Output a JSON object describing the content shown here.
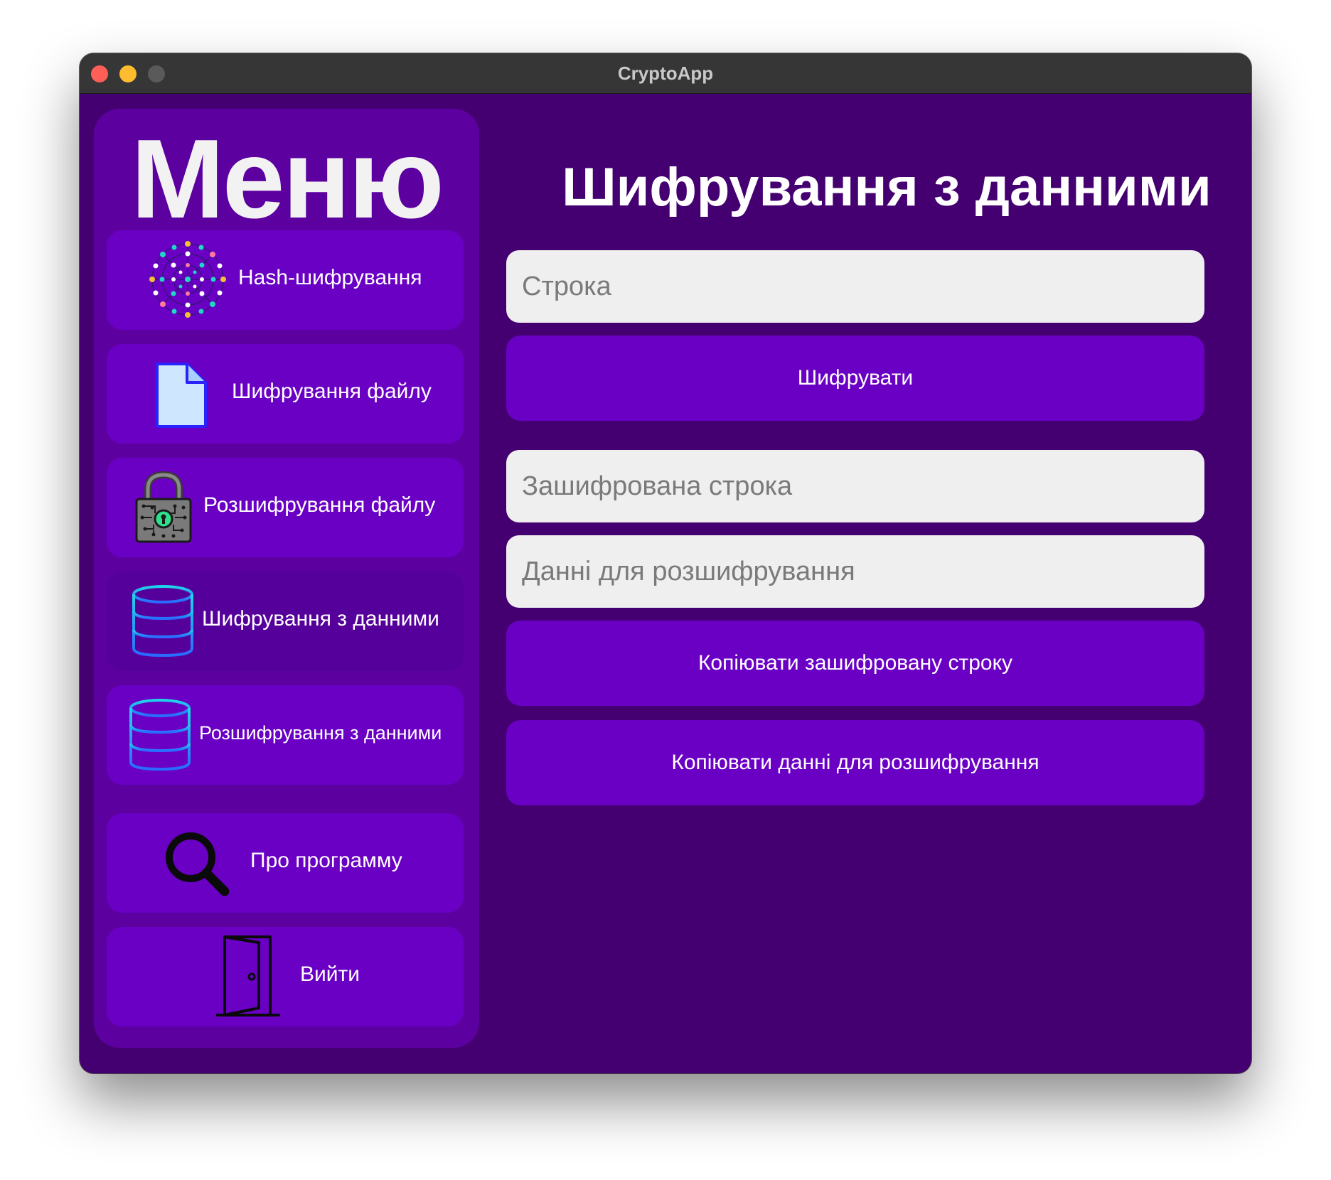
{
  "window": {
    "title": "CryptoApp"
  },
  "sidebar": {
    "title": "Меню",
    "items": [
      {
        "label": "Hash-шифрування",
        "icon": "hash-network-icon"
      },
      {
        "label": "Шифрування файлу",
        "icon": "file-icon"
      },
      {
        "label": "Розшифрування файлу",
        "icon": "padlock-icon"
      },
      {
        "label": "Шифрування з данними",
        "icon": "database-icon",
        "active": true
      },
      {
        "label": "Розшифрування з данними",
        "icon": "database-icon"
      },
      {
        "label": "Про программу",
        "icon": "magnifier-icon"
      },
      {
        "label": "Вийти",
        "icon": "door-icon"
      }
    ]
  },
  "main": {
    "title": "Шифрування з данними",
    "input_placeholder": "Строка",
    "encrypt_button": "Шифрувати",
    "encrypted_placeholder": "Зашифрована строка",
    "decrypt_data_placeholder": "Данні для розшифрування",
    "copy_encrypted_button": "Копіювати зашифровану строку",
    "copy_decrypt_data_button": "Копіювати данні для розшифрування"
  },
  "colors": {
    "background": "#440070",
    "sidebar": "#5c00a0",
    "button": "#6a00c4",
    "active_item": "#56009c",
    "field": "#efefef"
  }
}
